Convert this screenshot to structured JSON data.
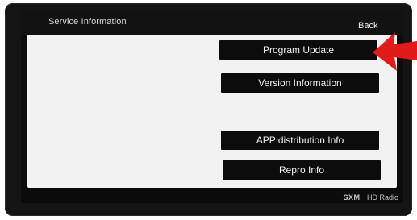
{
  "screen": {
    "title": "Service Information",
    "back_label": "Back"
  },
  "menu": {
    "program_update": "Program Update",
    "version_information": "Version Information",
    "app_distribution_info": "APP distribution Info",
    "repro_info": "Repro Info"
  },
  "footer": {
    "sxm_logo": "SXM",
    "hd_radio_logo": "HD Radio"
  },
  "colors": {
    "arrow": "#e11a1a",
    "panel": "#f2f2f2",
    "button": "#0c0c0c"
  }
}
